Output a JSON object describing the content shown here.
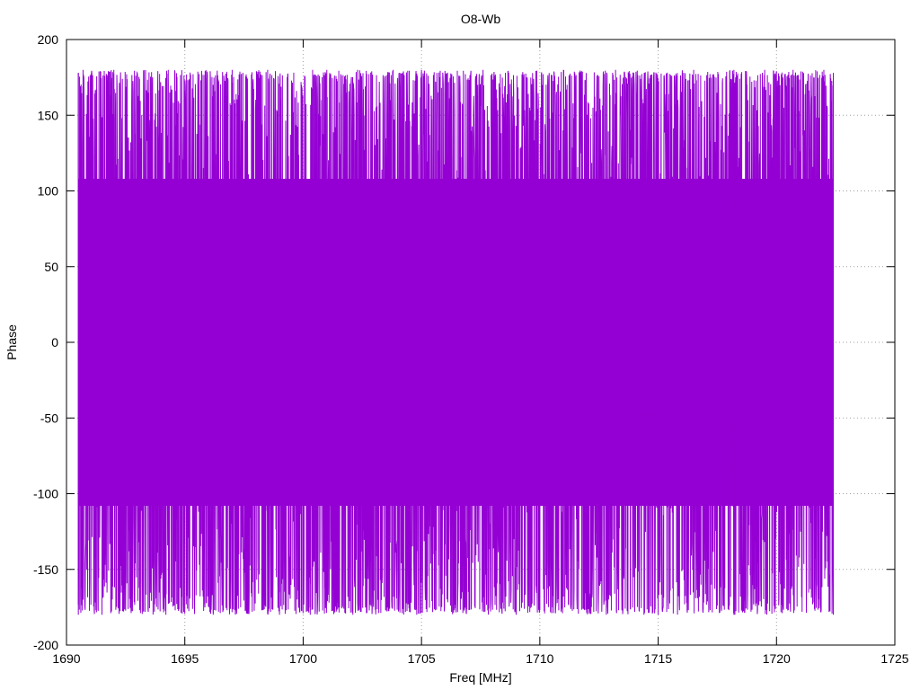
{
  "chart_data": {
    "type": "line",
    "title": "O8-Wb",
    "xlabel": "Freq [MHz]",
    "ylabel": "Phase",
    "xlim": [
      1690,
      1725
    ],
    "ylim": [
      -200,
      200
    ],
    "xticks": [
      1690,
      1695,
      1700,
      1705,
      1710,
      1715,
      1720,
      1725
    ],
    "yticks": [
      -200,
      -150,
      -100,
      -50,
      0,
      50,
      100,
      150,
      200
    ],
    "grid": true,
    "legend": "none",
    "series": [
      {
        "color": "#9400d3",
        "x_start": 1690.5,
        "x_end": 1722.4,
        "y_range": [
          -180,
          180
        ],
        "pattern": "dense noisy phase wrapping between -180 and 180",
        "sample_points": [
          {
            "x": 1690.5,
            "y": 178
          },
          {
            "x": 1690.7,
            "y": -170
          },
          {
            "x": 1691.5,
            "y": 80
          },
          {
            "x": 1692.0,
            "y": -95
          },
          {
            "x": 1694.2,
            "y": 57
          },
          {
            "x": 1694.3,
            "y": -80
          },
          {
            "x": 1696.2,
            "y": 170
          },
          {
            "x": 1697.0,
            "y": -98
          },
          {
            "x": 1698.5,
            "y": -44
          },
          {
            "x": 1699.0,
            "y": 66
          },
          {
            "x": 1700.3,
            "y": 56
          },
          {
            "x": 1700.4,
            "y": -22
          },
          {
            "x": 1701.0,
            "y": -50
          },
          {
            "x": 1702.1,
            "y": 64
          },
          {
            "x": 1702.3,
            "y": -38
          },
          {
            "x": 1703.8,
            "y": -42
          },
          {
            "x": 1704.8,
            "y": 41
          },
          {
            "x": 1705.0,
            "y": -75
          },
          {
            "x": 1707.6,
            "y": -45
          },
          {
            "x": 1709.0,
            "y": 110
          },
          {
            "x": 1711.0,
            "y": -85
          },
          {
            "x": 1713.2,
            "y": -72
          },
          {
            "x": 1714.4,
            "y": 68
          },
          {
            "x": 1715.0,
            "y": 15
          },
          {
            "x": 1716.5,
            "y": -72
          },
          {
            "x": 1718.2,
            "y": 68
          },
          {
            "x": 1718.2,
            "y": -40
          },
          {
            "x": 1719.5,
            "y": -95
          },
          {
            "x": 1720.7,
            "y": -60
          },
          {
            "x": 1722.0,
            "y": -90
          },
          {
            "x": 1722.4,
            "y": 178
          }
        ]
      }
    ]
  }
}
